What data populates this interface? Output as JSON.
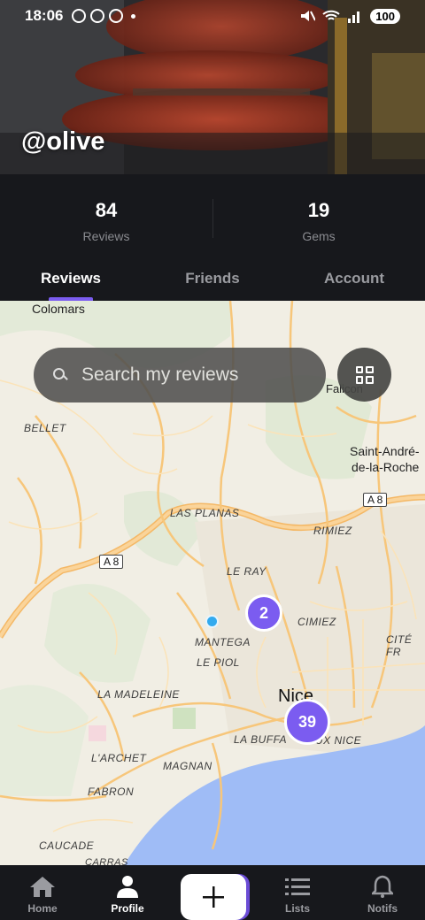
{
  "status_bar": {
    "time": "18:06",
    "battery": "100"
  },
  "profile": {
    "username": "@olive"
  },
  "stats": [
    {
      "value": "84",
      "label": "Reviews"
    },
    {
      "value": "19",
      "label": "Gems"
    }
  ],
  "tabs": [
    {
      "label": "Reviews",
      "active": true
    },
    {
      "label": "Friends",
      "active": false
    },
    {
      "label": "Account",
      "active": false
    }
  ],
  "search": {
    "placeholder": "Search my reviews"
  },
  "map": {
    "places": {
      "colomars": "Colomars",
      "falicon": "Falicon",
      "bellet": "BELLET",
      "saint_andre_1": "Saint-André-",
      "saint_andre_2": "de-la-Roche",
      "las_planas": "LAS PLANAS",
      "rimiez": "RIMIEZ",
      "le_ray": "LE RAY",
      "cimiez": "CIMIEZ",
      "mantega": "MANTEGA",
      "le_piol": "LE PIOL",
      "cite_fr": "CITÉ FR",
      "la_madeleine": "LA MADELEINE",
      "nice": "Nice",
      "l_archet": "L'ARCHET",
      "la_buffa": "LA BUFFA",
      "vieux_nice": "UX NICE",
      "magnan": "MAGNAN",
      "fabron": "FABRON",
      "caucade": "CAUCADE",
      "carras": "CARRAS"
    },
    "roads": {
      "a8_west": "A 8",
      "a8_east": "A 8"
    },
    "clusters": [
      {
        "id": "cluster-small",
        "count": "2"
      },
      {
        "id": "cluster-nice",
        "count": "39"
      }
    ]
  },
  "bottom_nav": [
    {
      "label": "Home",
      "icon": "home-icon",
      "active": false
    },
    {
      "label": "Profile",
      "icon": "profile-icon",
      "active": true
    },
    {
      "label": "",
      "icon": "plus-icon",
      "active": false
    },
    {
      "label": "Lists",
      "icon": "list-icon",
      "active": false
    },
    {
      "label": "Notifs",
      "icon": "bell-icon",
      "active": false
    }
  ],
  "colors": {
    "accent": "#7b5cf0",
    "background": "#17181c",
    "map_water": "#9fbcf6",
    "map_road": "#f7c67a"
  }
}
